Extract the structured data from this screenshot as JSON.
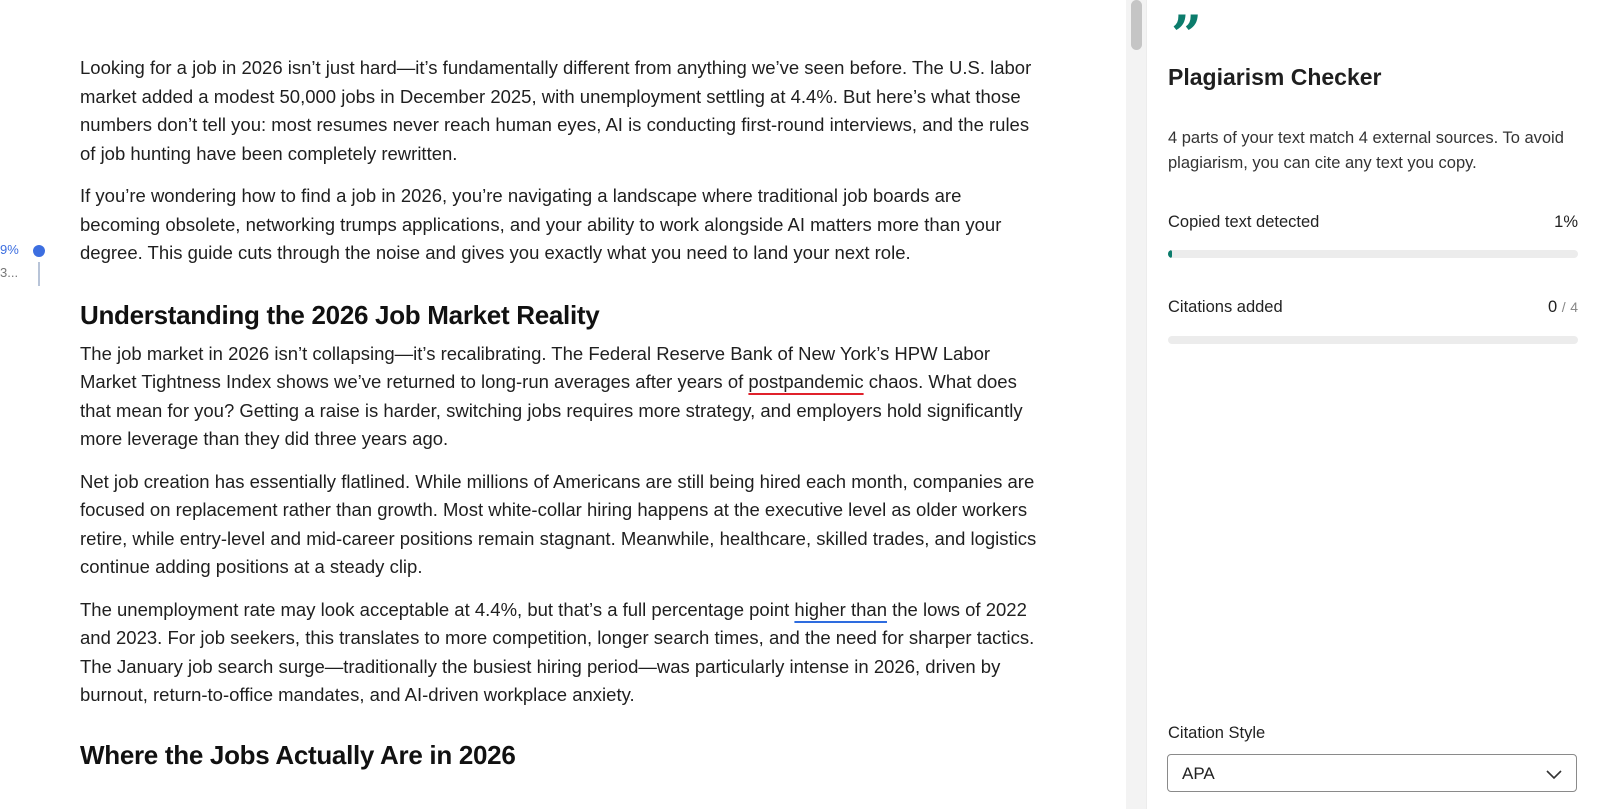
{
  "document": {
    "paragraphs": [
      "Looking for a job in 2026 isn’t just hard—it’s fundamentally different from anything we’ve seen before. The U.S. labor market added a modest 50,000 jobs in December 2025, with unemployment settling at 4.4%. But here’s what those numbers don’t tell you: most resumes never reach human eyes, AI is conducting first-round interviews, and the rules of job hunting have been completely rewritten.",
      "If you’re wondering how to find a job in 2026, you’re navigating a landscape where traditional job boards are becoming obsolete, networking trumps applications, and your ability to work alongside AI matters more than your degree. This guide cuts through the noise and gives you exactly what you need to land your next role."
    ],
    "heading_1": "Understanding the 2026 Job Market Reality",
    "para3": {
      "before": "The job market in 2026 isn’t collapsing—it’s recalibrating. The Federal Reserve Bank of New York’s HPW Labor Market Tightness Index shows we’ve returned to long-run averages after years of ",
      "flagged": "postpandemic",
      "after": " chaos. What does that mean for you? Getting a raise is harder, switching jobs requires more strategy, and employers hold significantly more leverage than they did three years ago."
    },
    "para4": "Net job creation has essentially flatlined. While millions of Americans are still being hired each month, companies are focused on replacement rather than growth. Most white-collar hiring happens at the executive level as older workers retire, while entry-level and mid-career positions remain stagnant. Meanwhile, healthcare, skilled trades, and logistics continue adding positions at a steady clip.",
    "para5": {
      "before": "The unemployment rate may look acceptable at 4.4%, but that’s a full percentage point ",
      "flagged": "higher than",
      "after": " the lows of 2022 and 2023. For job seekers, this translates to more competition, longer search times, and the need for sharper tactics. The January job search surge—traditionally the busiest hiring period—was particularly intense in 2026, driven by burnout, return-to-office mandates, and AI-driven workplace anxiety."
    },
    "heading_2": "Where the Jobs Actually Are in 2026"
  },
  "gutter": {
    "percent": "9%",
    "sub": "3..."
  },
  "panel": {
    "icon": "quote-icon",
    "title": "Plagiarism Checker",
    "summary": "4 parts of your text match 4 external sources. To avoid plagiarism, you can cite any text you copy.",
    "copied_label": "Copied text detected",
    "copied_value": "1%",
    "copied_fraction": 0.01,
    "citations_label": "Citations added",
    "citations_count": "0",
    "citations_total": "4",
    "citations_fraction": 0,
    "style_label": "Citation Style",
    "style_value": "APA"
  },
  "colors": {
    "accent": "#0c7c6c",
    "flag_red": "#e0212b",
    "flag_blue": "#2e6cdf",
    "gutter_blue": "#3c6ee0"
  }
}
